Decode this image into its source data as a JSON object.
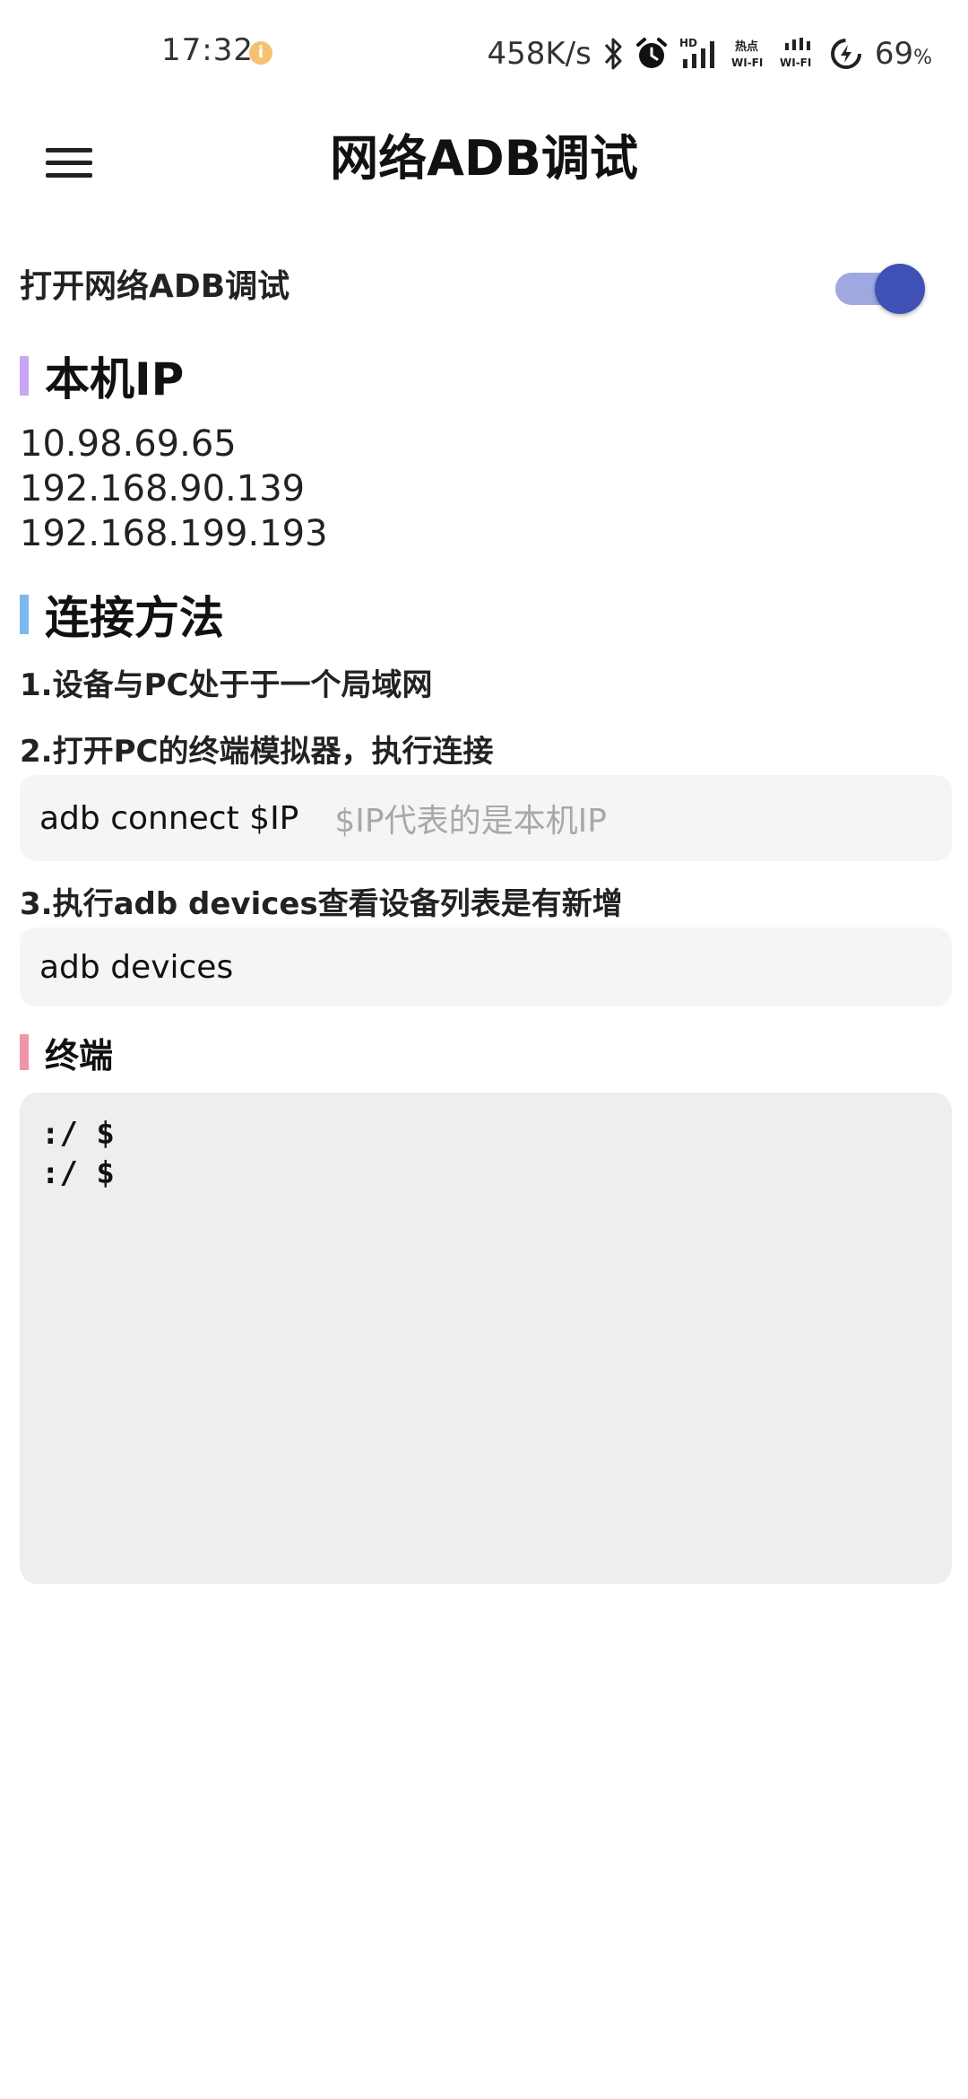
{
  "status_bar": {
    "time": "17:32",
    "notify_icon": "info-dot-icon",
    "net_speed": "458K/s",
    "icons": [
      "bluetooth-icon",
      "alarm-icon",
      "hd-signal-icon",
      "hotspot-wifi-icon",
      "wifi-signal-icon",
      "battery-charging-icon"
    ],
    "hd_label": "HD",
    "hotspot_label_top": "热点",
    "wifi_label": "WI-FI",
    "battery_value": "69",
    "battery_unit": "%"
  },
  "app_bar": {
    "menu_icon": "hamburger-menu-icon",
    "title": "网络ADB调试"
  },
  "toggle": {
    "label": "打开网络ADB调试",
    "on": true,
    "track_color": "#9fa8e0",
    "thumb_color": "#3f51b5"
  },
  "local_ip": {
    "title": "本机IP",
    "accent": "#c9a6f5",
    "ips": [
      "10.98.69.65",
      "192.168.90.139",
      "192.168.199.193"
    ]
  },
  "method": {
    "title": "连接方法",
    "accent": "#7ab8f0",
    "step1": "1.设备与PC处于于一个局域网",
    "step2": "2.打开PC的终端模拟器，执行连接",
    "cmd1": "adb connect $IP",
    "cmd1_hint": "$IP代表的是本机IP",
    "step3": "3.执行adb devices查看设备列表是有新增",
    "cmd2": "adb devices"
  },
  "terminal": {
    "title": "终端",
    "accent": "#f095a8",
    "lines": [
      ":/ $",
      ":/ $"
    ]
  }
}
